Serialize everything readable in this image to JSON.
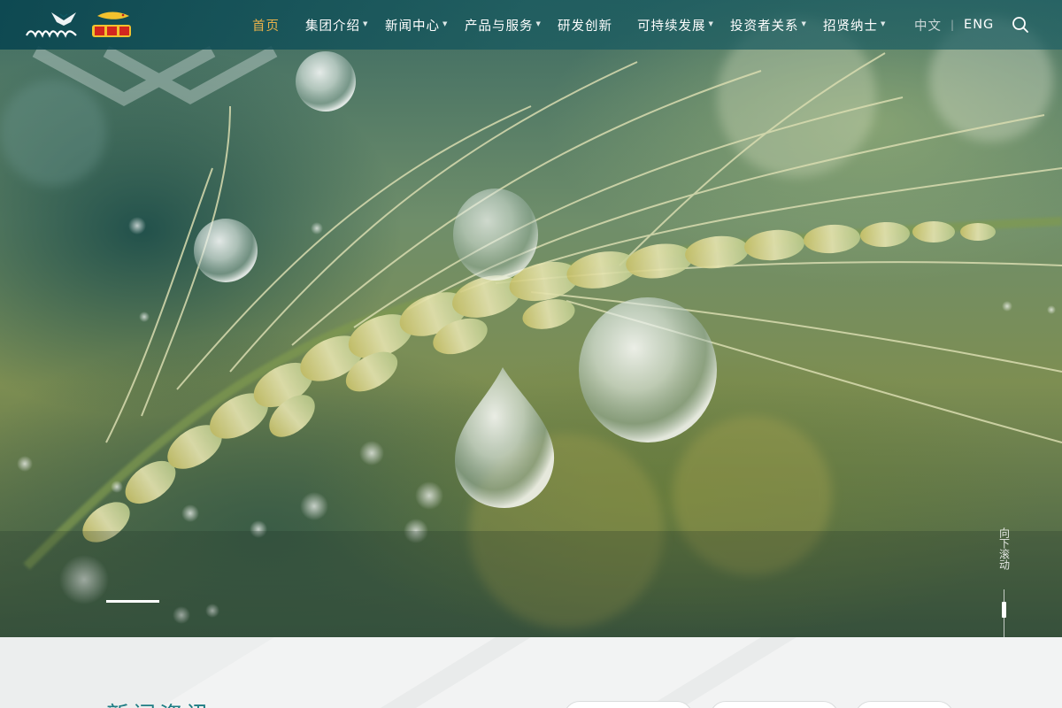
{
  "brand": {
    "logo_left_text": "鲁海嘉里",
    "logo_right_text": "金龙鱼",
    "colors": {
      "accent_active": "#e9b24a",
      "header_teal": "#0f5a64",
      "section_title": "#1f7d84"
    }
  },
  "nav": {
    "items": [
      {
        "label": "首页",
        "active": true,
        "has_dropdown": false
      },
      {
        "label": "集团介绍",
        "active": false,
        "has_dropdown": true
      },
      {
        "label": "新闻中心",
        "active": false,
        "has_dropdown": true
      },
      {
        "label": "产品与服务",
        "active": false,
        "has_dropdown": true
      },
      {
        "label": "研发创新",
        "active": false,
        "has_dropdown": false
      },
      {
        "label": "可持续发展",
        "active": false,
        "has_dropdown": true
      },
      {
        "label": "投资者关系",
        "active": false,
        "has_dropdown": true
      },
      {
        "label": "招贤纳士",
        "active": false,
        "has_dropdown": true
      }
    ],
    "caret_glyph": "▼"
  },
  "lang": {
    "zh": "中文",
    "sep": "|",
    "en": "ENG"
  },
  "search": {
    "icon": "search-icon"
  },
  "hero": {
    "image": "wheat-ear-with-water-droplets",
    "slides_total": 1,
    "active_slide": 1
  },
  "scroll_hint": {
    "text": "向下滚动"
  },
  "news": {
    "title": "新闻资讯",
    "tabs_visible": 3
  }
}
